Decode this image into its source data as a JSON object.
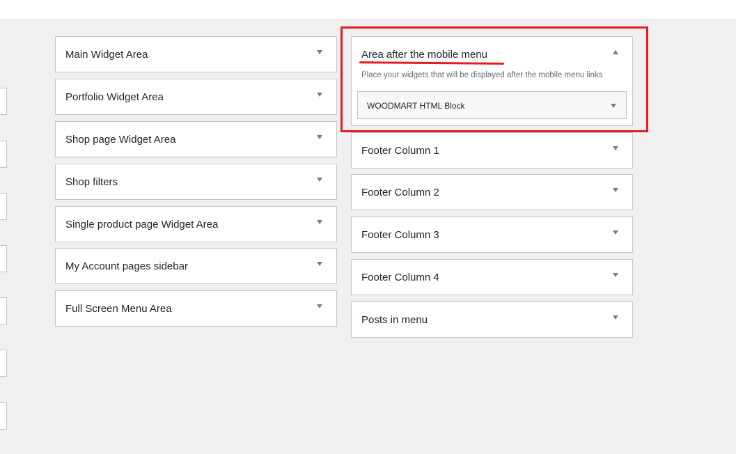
{
  "colors": {
    "page_bg": "#f0f0f1",
    "panel_bg": "#ffffff",
    "border": "#c3c4c7",
    "annotation_red": "#e31b23"
  },
  "left_column": [
    {
      "title": "Main Widget Area",
      "icon": "chevron-down-icon"
    },
    {
      "title": "Portfolio Widget Area",
      "icon": "chevron-down-icon"
    },
    {
      "title": "Shop page Widget Area",
      "icon": "chevron-down-icon"
    },
    {
      "title": "Shop filters",
      "icon": "chevron-down-icon"
    },
    {
      "title": "Single product page Widget Area",
      "icon": "chevron-down-icon"
    },
    {
      "title": "My Account pages sidebar",
      "icon": "chevron-down-icon"
    },
    {
      "title": "Full Screen Menu Area",
      "icon": "chevron-down-icon"
    }
  ],
  "open_area": {
    "title": "Area after the mobile menu",
    "icon": "chevron-up-icon",
    "description": "Place your widgets that will be displayed after the mobile menu links",
    "widget": {
      "title": "WOODMART HTML Block",
      "icon": "chevron-down-icon"
    }
  },
  "right_column": [
    {
      "title": "Footer Column 1",
      "icon": "chevron-down-icon"
    },
    {
      "title": "Footer Column 2",
      "icon": "chevron-down-icon"
    },
    {
      "title": "Footer Column 3",
      "icon": "chevron-down-icon"
    },
    {
      "title": "Footer Column 4",
      "icon": "chevron-down-icon"
    },
    {
      "title": "Posts in menu",
      "icon": "chevron-down-icon"
    }
  ]
}
